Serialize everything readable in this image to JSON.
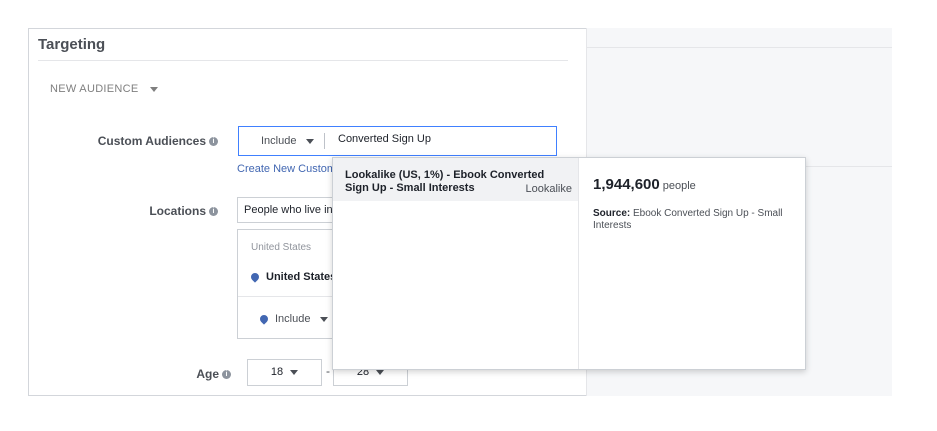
{
  "section": {
    "title": "Targeting",
    "new_audience_label": "NEW AUDIENCE"
  },
  "custom_audiences": {
    "label": "Custom Audiences",
    "include_label": "Include",
    "input_value": "Converted Sign Up",
    "create_link": "Create New Custom Audience"
  },
  "locations": {
    "label": "Locations",
    "select_value": "People who live in this location",
    "group_label": "United States",
    "selected_item": "United States",
    "include_label": "Include"
  },
  "age": {
    "label": "Age",
    "min": "18",
    "dash": "-",
    "max": "28"
  },
  "dropdown": {
    "item_name": "Lookalike (US, 1%) - Ebook Converted Sign Up - Small Interests",
    "item_type": "Lookalike",
    "audience_size": "1,944,600",
    "audience_unit": "people",
    "source_label": "Source:",
    "source_value": "Ebook Converted Sign Up - Small Interests"
  },
  "icons": {
    "info": "info-icon",
    "caret": "caret-down-icon",
    "location": "location-pin-icon"
  }
}
